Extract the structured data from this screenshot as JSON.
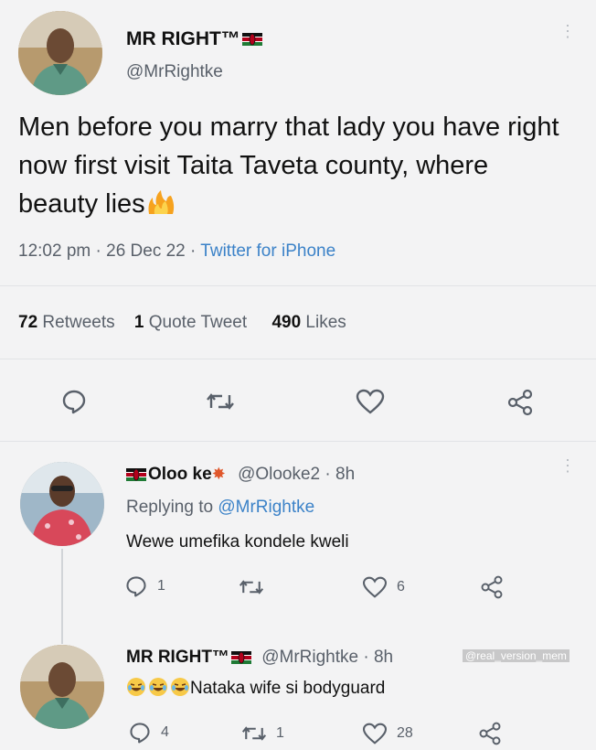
{
  "main_tweet": {
    "display_name": "MR RIGHT™",
    "handle": "@MrRightke",
    "text": "Men before you marry that lady you have right now first visit Taita Taveta county, where beauty lies",
    "time": "12:02 pm",
    "date": "26 Dec 22",
    "source": "Twitter for iPhone",
    "stats": {
      "retweets_count": "72",
      "retweets_label": "Retweets",
      "quotes_count": "1",
      "quotes_label": "Quote Tweet",
      "likes_count": "490",
      "likes_label": "Likes"
    }
  },
  "reply1": {
    "display_name": "Oloo ke",
    "handle": "@Olooke2",
    "age": "8h",
    "replying_prefix": "Replying to",
    "replying_handle": "@MrRightke",
    "text": "Wewe umefika kondele kweli",
    "replies": "1",
    "likes": "6"
  },
  "reply2": {
    "display_name": "MR RIGHT™",
    "handle": "@MrRightke",
    "age": "8h",
    "text": "Nataka wife si bodyguard",
    "replies": "4",
    "retweets": "1",
    "likes": "28"
  },
  "watermark": "@real_version_mem",
  "colors": {
    "background": "#f3f3f4",
    "link": "#3b82c8",
    "muted": "#59606a"
  }
}
